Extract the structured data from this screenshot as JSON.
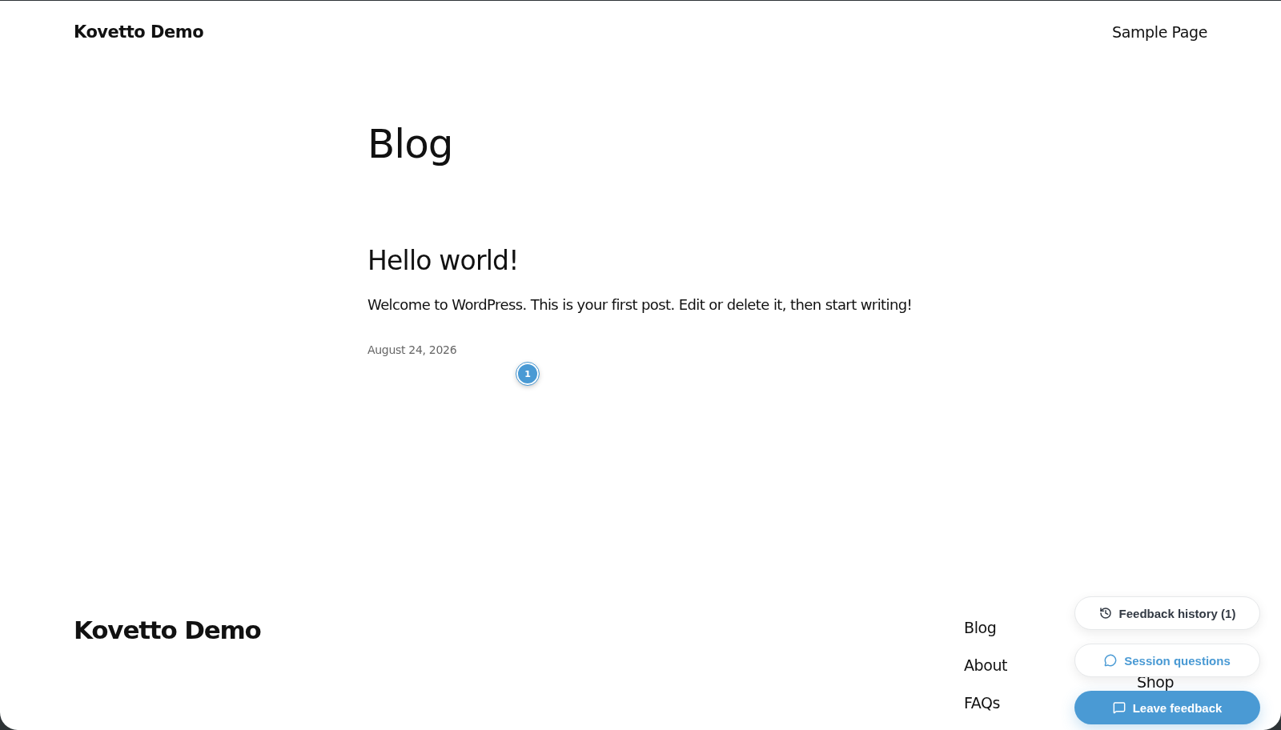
{
  "header": {
    "site_title": "Kovetto Demo",
    "nav": [
      "Sample Page"
    ]
  },
  "page_title": "Blog",
  "posts": [
    {
      "title": "Hello world!",
      "excerpt": "Welcome to WordPress. This is your first post. Edit or delete it, then start writing!",
      "date": "August 24, 2026"
    }
  ],
  "feedback_marker": {
    "label": "1"
  },
  "footer": {
    "site_title": "Kovetto Demo",
    "column_1": [
      "Blog",
      "About",
      "FAQs"
    ],
    "column_2": [
      "Shop"
    ]
  },
  "feedback_widget": [
    {
      "kind": "history",
      "label": "Feedback history (1)"
    },
    {
      "kind": "questions",
      "label": "Session questions"
    },
    {
      "kind": "leave",
      "label": "Leave feedback"
    }
  ]
}
